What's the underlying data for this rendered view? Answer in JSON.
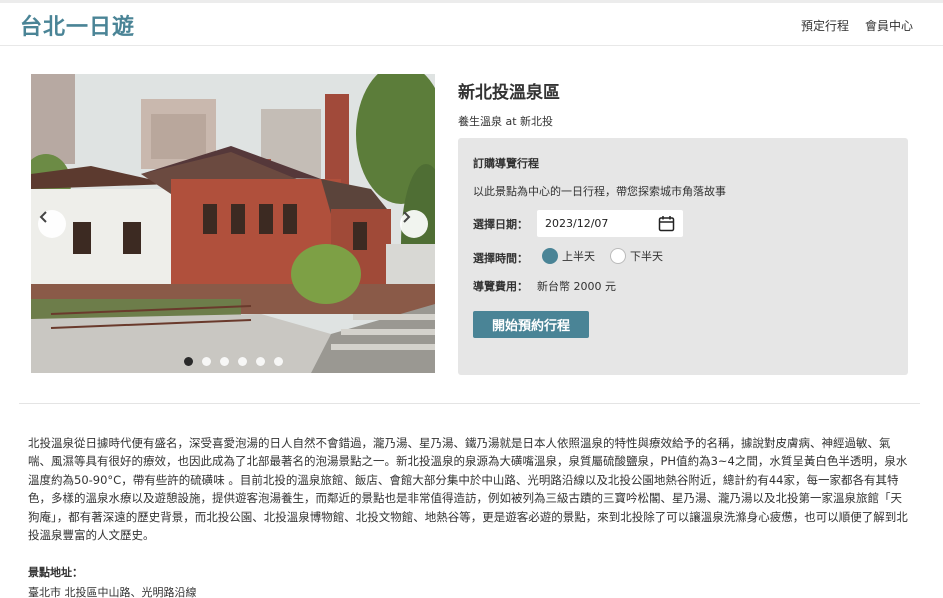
{
  "header": {
    "brand": "台北一日遊",
    "nav": [
      "預定行程",
      "會員中心"
    ]
  },
  "carousel": {
    "slide_count": 6,
    "active_index": 0
  },
  "attraction": {
    "name": "新北投溫泉區",
    "category_line": "養生溫泉 at 新北投"
  },
  "booking": {
    "title": "訂購導覽行程",
    "description": "以此景點為中心的一日行程，帶您探索城市角落故事",
    "date_label": "選擇日期：",
    "date_value": "2023/12/07",
    "time_label": "選擇時間：",
    "time_options": [
      "上半天",
      "下半天"
    ],
    "time_selected": "上半天",
    "fee_label": "導覽費用：",
    "fee_value": "新台幣 2000 元",
    "submit_label": "開始預約行程"
  },
  "details": {
    "description": "北投溫泉從日據時代便有盛名，深受喜愛泡湯的日人自然不會錯過，瀧乃湯、星乃湯、鐵乃湯就是日本人依照溫泉的特性與療效給予的名稱，據說對皮膚病、神經過敏、氣喘、風濕等具有很好的療效，也因此成為了北部最著名的泡湯景點之一。新北投溫泉的泉源為大磺嘴溫泉，泉質屬硫酸鹽泉，PH值約為3~4之間，水質呈黃白色半透明，泉水溫度約為50-90°C，帶有些許的硫磺味 。目前北投的溫泉旅館、飯店、會館大部分集中於中山路、光明路沿線以及北投公園地熱谷附近，總計約有44家，每一家都各有其特色，多樣的溫泉水療以及遊憩設施，提供遊客泡湯養生，而鄰近的景點也是非常值得造訪，例如被列為三級古蹟的三寶吟松閣、星乃湯、瀧乃湯以及北投第一家溫泉旅館「天狗庵」，都有著深遠的歷史背景，而北投公園、北投溫泉博物館、北投文物館、地熱谷等，更是遊客必遊的景點，來到北投除了可以讓溫泉洗滌身心疲憊，也可以順便了解到北投溫泉豐富的人文歷史。",
    "address_label": "景點地址：",
    "address_value": "臺北市 北投區中山路、光明路沿線"
  },
  "colors": {
    "brand": "#4a8496",
    "panel_bg": "#e6e6e6"
  }
}
